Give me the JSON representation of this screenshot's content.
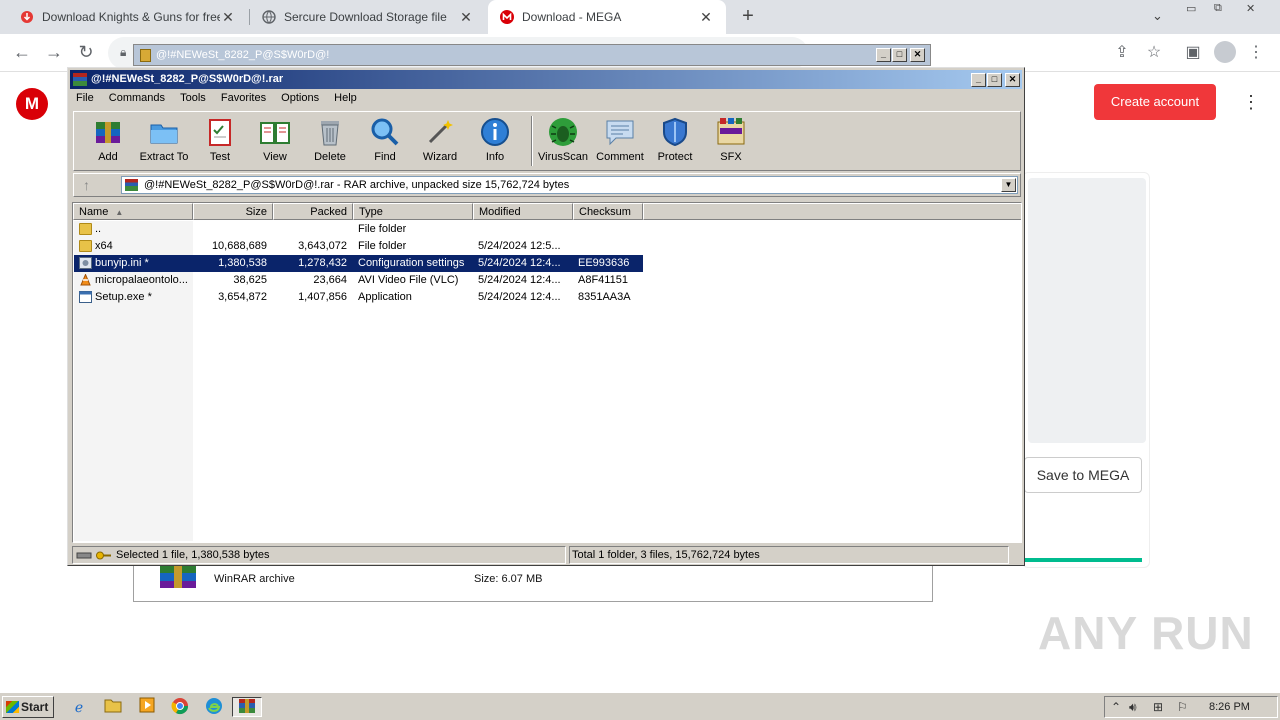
{
  "browser": {
    "tabs": [
      {
        "title": "Download Knights & Guns for free o",
        "icon": "download-icon"
      },
      {
        "title": "Sercure Download Storage file",
        "icon": "globe-icon"
      },
      {
        "title": "Download - MEGA",
        "icon": "mega-icon"
      }
    ],
    "new_tab": "+",
    "background_window_title": "@!#NEWeSt_8282_P@S$W0rD@!"
  },
  "mega": {
    "logo": "M",
    "create_account": "Create account",
    "save_to_mega": "Save to MEGA",
    "file_type": "WinRAR archive",
    "file_size": "Size: 6.07 MB",
    "accent": "#f0373a"
  },
  "watermark": "ANY RUN",
  "winrar": {
    "title": "@!#NEWeSt_8282_P@S$W0rD@!.rar",
    "menu": [
      "File",
      "Commands",
      "Tools",
      "Favorites",
      "Options",
      "Help"
    ],
    "toolbar": [
      "Add",
      "Extract To",
      "Test",
      "View",
      "Delete",
      "Find",
      "Wizard",
      "Info",
      "VirusScan",
      "Comment",
      "Protect",
      "SFX"
    ],
    "address": "@!#NEWeSt_8282_P@S$W0rD@!.rar - RAR archive, unpacked size 15,762,724 bytes",
    "columns": [
      "Name",
      "Size",
      "Packed",
      "Type",
      "Modified",
      "Checksum"
    ],
    "rows": [
      {
        "name": "..",
        "size": "",
        "packed": "",
        "type": "File folder",
        "modified": "",
        "checksum": ""
      },
      {
        "name": "x64",
        "size": "10,688,689",
        "packed": "3,643,072",
        "type": "File folder",
        "modified": "5/24/2024 12:5...",
        "checksum": ""
      },
      {
        "name": "bunyip.ini *",
        "size": "1,380,538",
        "packed": "1,278,432",
        "type": "Configuration settings",
        "modified": "5/24/2024 12:4...",
        "checksum": "EE993636"
      },
      {
        "name": "micropalaeontolo...",
        "size": "38,625",
        "packed": "23,664",
        "type": "AVI Video File (VLC)",
        "modified": "5/24/2024 12:4...",
        "checksum": "A8F41151"
      },
      {
        "name": "Setup.exe *",
        "size": "3,654,872",
        "packed": "1,407,856",
        "type": "Application",
        "modified": "5/24/2024 12:4...",
        "checksum": "8351AA3A"
      }
    ],
    "status_left": "Selected 1 file, 1,380,538 bytes",
    "status_right": "Total 1 folder, 3 files, 15,762,724 bytes"
  },
  "taskbar": {
    "start": "Start",
    "clock": "8:26 PM"
  }
}
